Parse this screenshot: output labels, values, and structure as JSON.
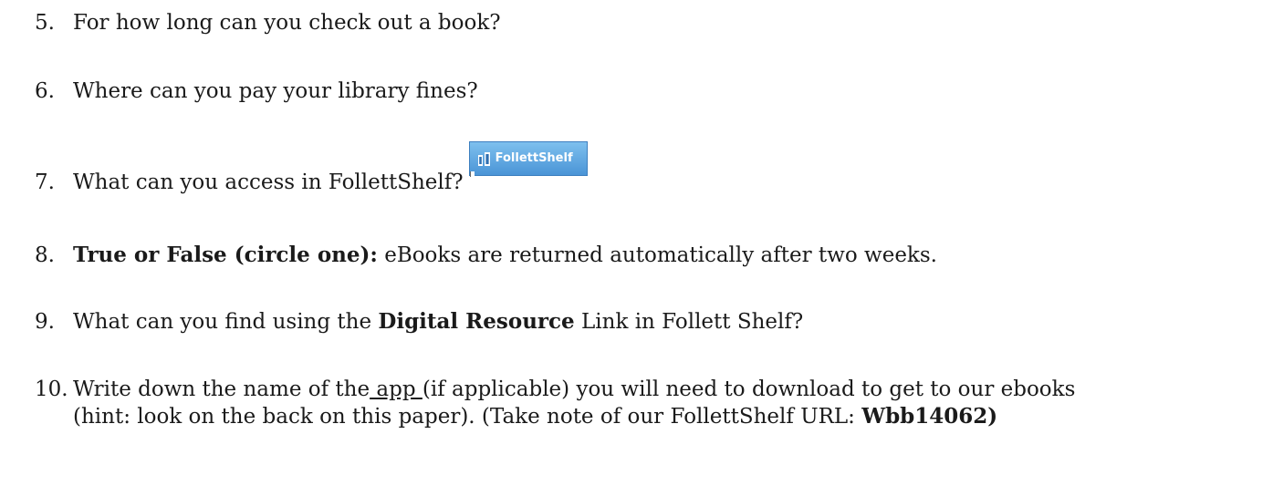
{
  "questions": [
    {
      "num": "5.",
      "text": "For how long can you check out a book?"
    },
    {
      "num": "6.",
      "text": "Where can you pay your library fines?"
    },
    {
      "num": "7.",
      "text": "What can you access in FollettShelf?"
    },
    {
      "num": "8.",
      "bold": "True or False (circle one):",
      "text": " eBooks are returned automatically after two weeks."
    },
    {
      "num": "9.",
      "pre": "What can you find using the ",
      "bold": "Digital Resource",
      "post": " Link in Follett Shelf?"
    },
    {
      "num": "10.",
      "pre": "Write down the name of the",
      "underlined": " app ",
      "post": "(if applicable) you will need to download to get to our ebooks",
      "line2_text": "(hint: look on the back on this paper).  (Take note of our FollettShelf URL: ",
      "line2_bold": "Wbb14062)"
    }
  ],
  "follett_button": {
    "label": "FollettShelf",
    "icon": "books-icon",
    "bg_top": "#7ec0ee",
    "bg_bottom": "#4a94d6"
  }
}
